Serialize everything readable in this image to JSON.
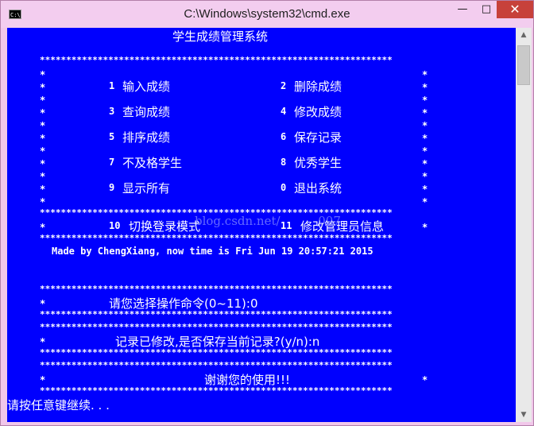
{
  "window": {
    "title": "C:\\Windows\\system32\\cmd.exe",
    "icon_text": "C:\\",
    "minimize": "—",
    "maximize": "□",
    "close": "✕"
  },
  "console": {
    "header": "学生成绩管理系统",
    "star_row": "*******************************************************************",
    "star": "*",
    "menu": [
      {
        "num": "1",
        "label": "输入成绩",
        "num2": "2",
        "label2": "删除成绩"
      },
      {
        "num": "3",
        "label": "查询成绩",
        "num2": "4",
        "label2": "修改成绩"
      },
      {
        "num": "5",
        "label": "排序成绩",
        "num2": "6",
        "label2": "保存记录"
      },
      {
        "num": "7",
        "label": "不及格学生",
        "num2": "8",
        "label2": "优秀学生"
      },
      {
        "num": "9",
        "label": "显示所有",
        "num2": "0",
        "label2": "退出系统"
      }
    ],
    "extra": {
      "num": "10",
      "label": "切换登录模式",
      "num2": "11",
      "label2": "修改管理员信息"
    },
    "made_by": "Made by ChengXiang, now time is Fri Jun 19 20:57:21 2015",
    "prompt_choose": "请您选择操作命令(0~11):0",
    "prompt_save": "记录已修改,是否保存当前记录?(y/n):n",
    "thanks": "谢谢您的使用!!!",
    "press_key": "请按任意键继续. . .",
    "watermark": "blog.csdn.net/          007"
  },
  "colors": {
    "console_bg": "#0000fe",
    "console_fg": "#ffffff",
    "titlebar": "#f3cdef",
    "close_btn": "#c7413b"
  }
}
